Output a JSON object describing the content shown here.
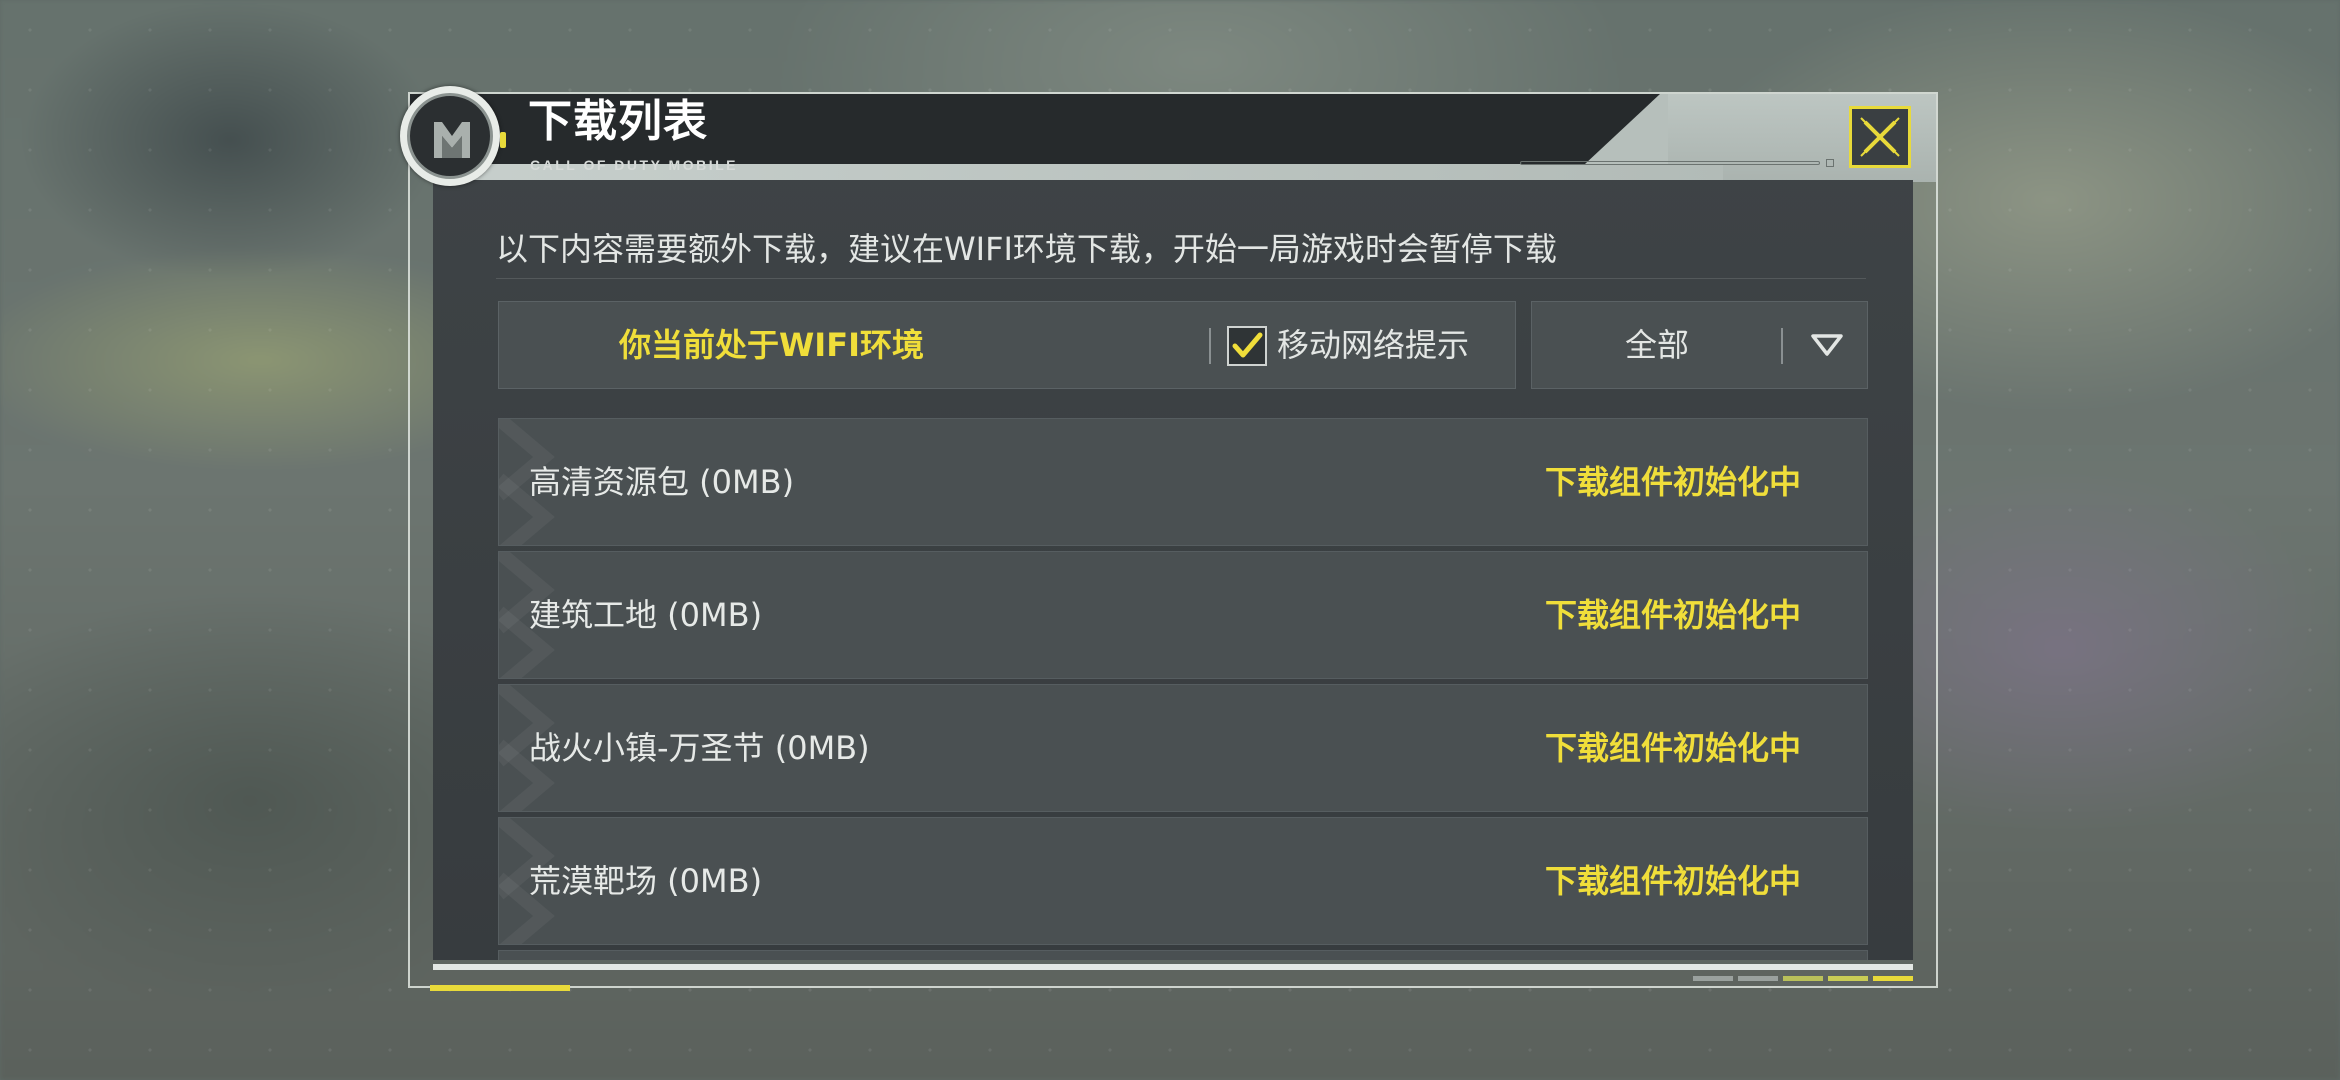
{
  "dialog": {
    "title": "下载列表",
    "subtitle": "CALL OF DUTY MOBILE",
    "notice": "以下内容需要额外下载，建议在WIFI环境下载，开始一局游戏时会暂停下载"
  },
  "network": {
    "status": "你当前处于WIFI环境",
    "mobile_prompt_label": "移动网络提示",
    "mobile_prompt_checked": true
  },
  "filter": {
    "selected": "全部"
  },
  "downloads": [
    {
      "name": "高清资源包 (0MB)",
      "status": "下载组件初始化中"
    },
    {
      "name": "建筑工地 (0MB)",
      "status": "下载组件初始化中"
    },
    {
      "name": "战火小镇-万圣节 (0MB)",
      "status": "下载组件初始化中"
    },
    {
      "name": "荒漠靶场 (0MB)",
      "status": "下载组件初始化中"
    }
  ],
  "colors": {
    "accent_yellow": "#f0de3a",
    "panel": "#3a3f42",
    "row": "#4a5052"
  },
  "icons": {
    "logo": "cod-logo-icon",
    "close": "close-icon",
    "checkbox": "checkmark-icon",
    "dropdown": "triangle-down-icon"
  }
}
